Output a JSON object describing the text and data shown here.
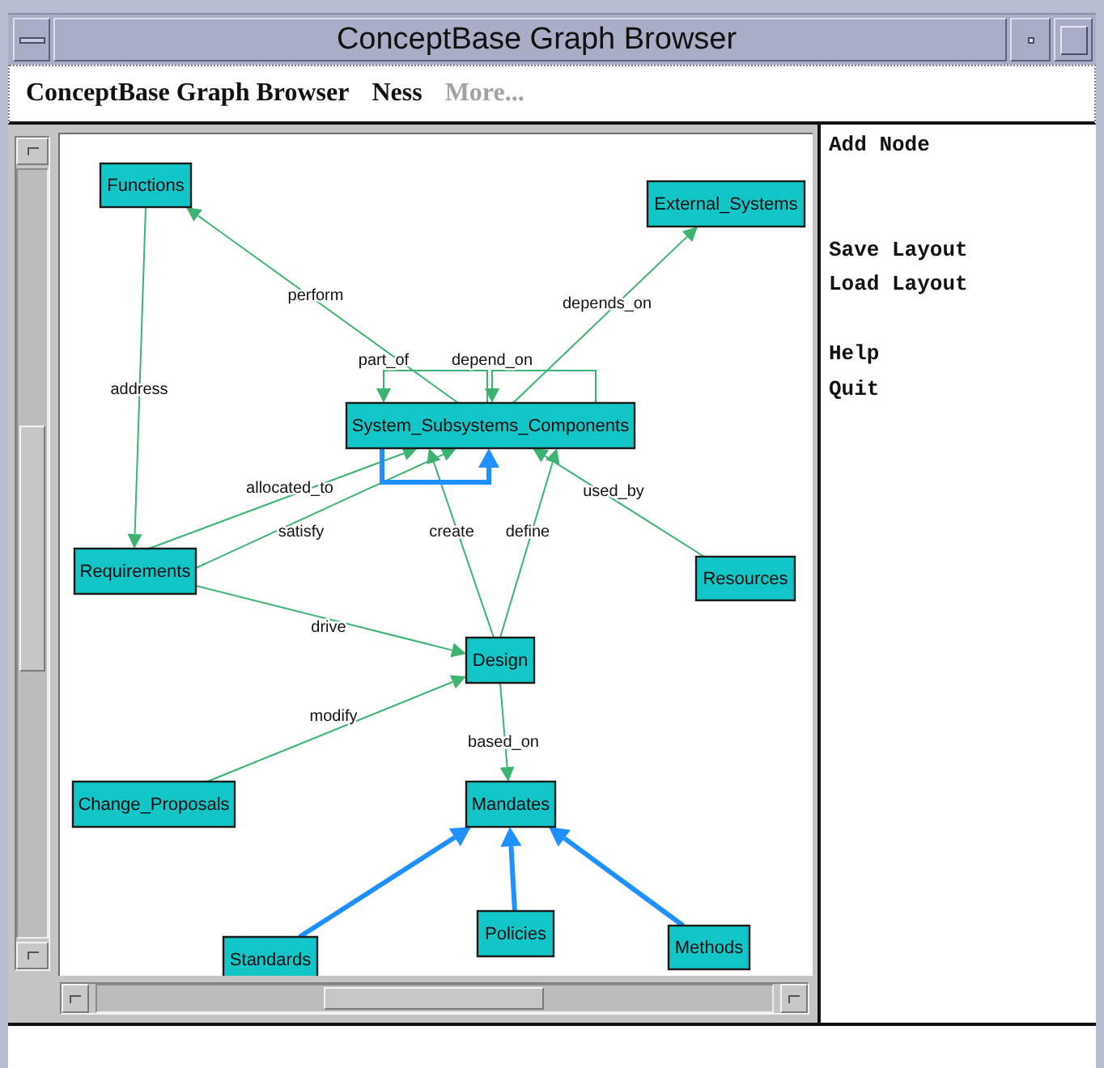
{
  "window": {
    "title": "ConceptBase Graph Browser"
  },
  "menu_bar": [
    {
      "label": "ConceptBase Graph Browser",
      "disabled": false
    },
    {
      "label": "Ness",
      "disabled": false
    },
    {
      "label": "More...",
      "disabled": true
    }
  ],
  "graph": {
    "nodes": [
      {
        "label": "Functions"
      },
      {
        "label": "External_Systems"
      },
      {
        "label": "System_Subsystems_Components"
      },
      {
        "label": "Requirements"
      },
      {
        "label": "Resources"
      },
      {
        "label": "Design"
      },
      {
        "label": "Change_Proposals"
      },
      {
        "label": "Mandates"
      },
      {
        "label": "Standards"
      },
      {
        "label": "Policies"
      },
      {
        "label": "Methods"
      }
    ],
    "edges": [
      {
        "label": "perform",
        "kind": "link"
      },
      {
        "label": "depends_on",
        "kind": "link"
      },
      {
        "label": "part_of",
        "kind": "link"
      },
      {
        "label": "depend_on",
        "kind": "link"
      },
      {
        "label": "address",
        "kind": "link"
      },
      {
        "label": "allocated_to",
        "kind": "link"
      },
      {
        "label": "satisfy",
        "kind": "link"
      },
      {
        "label": "create",
        "kind": "link"
      },
      {
        "label": "define",
        "kind": "link"
      },
      {
        "label": "used_by",
        "kind": "link"
      },
      {
        "kind": "isa"
      },
      {
        "label": "drive",
        "kind": "link"
      },
      {
        "label": "modify",
        "kind": "link"
      },
      {
        "label": "based_on",
        "kind": "link"
      },
      {
        "kind": "isa"
      },
      {
        "kind": "isa"
      },
      {
        "kind": "isa"
      }
    ]
  },
  "command_groups": [
    [
      "Add Node"
    ],
    [
      "Save Layout",
      "Load Layout"
    ],
    [
      "Help",
      "Quit"
    ]
  ]
}
